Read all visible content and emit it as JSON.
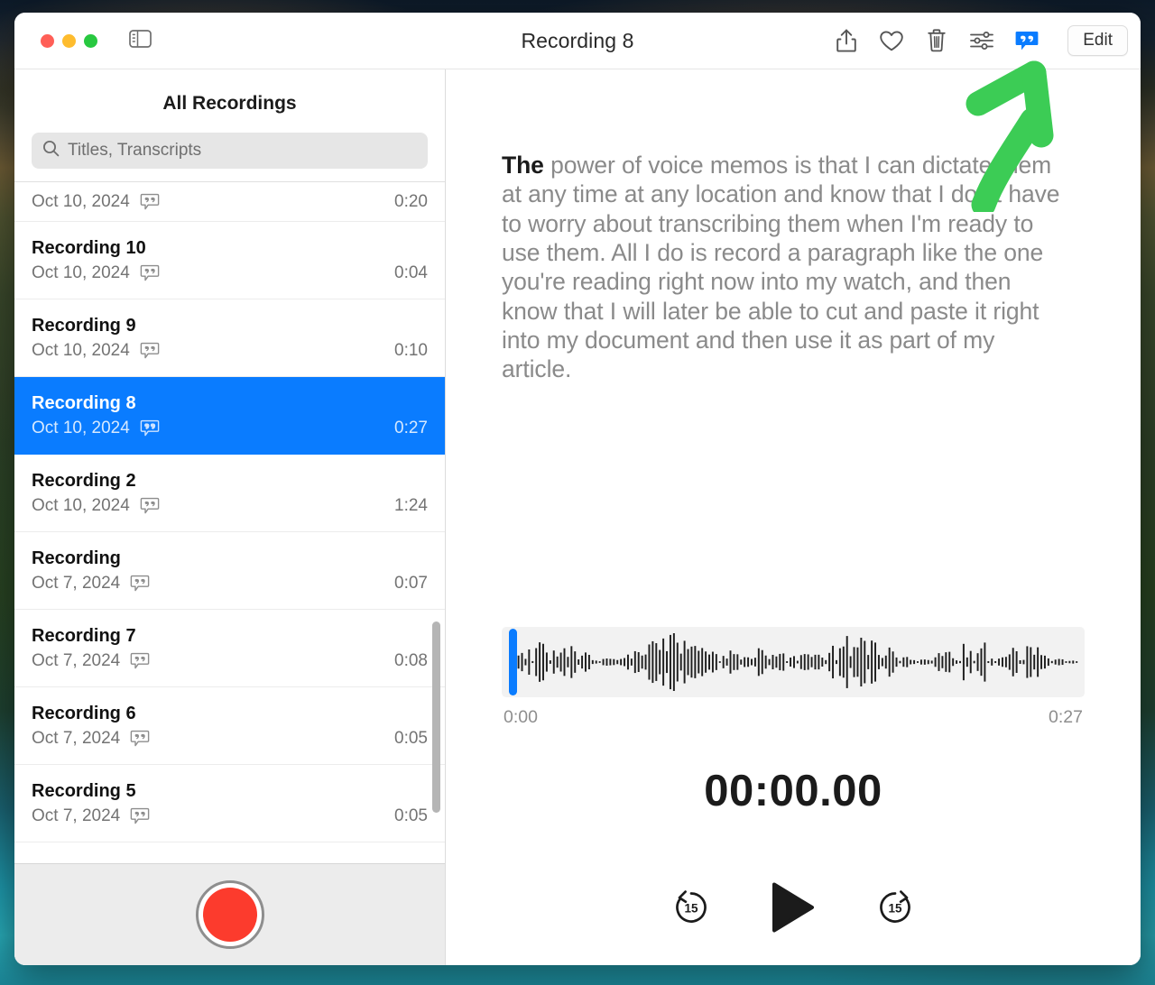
{
  "window": {
    "title": "Recording 8",
    "traffic_lights": [
      "close",
      "minimize",
      "maximize"
    ],
    "sidebar_toggle_icon": "sidebar-toggle-icon"
  },
  "toolbar": {
    "icons": [
      {
        "name": "share-icon",
        "label": "Share"
      },
      {
        "name": "heart-icon",
        "label": "Favorite"
      },
      {
        "name": "trash-icon",
        "label": "Delete"
      },
      {
        "name": "sliders-icon",
        "label": "Enhance"
      },
      {
        "name": "transcript-icon",
        "label": "Transcript",
        "active": true,
        "color": "#0a7cff"
      }
    ],
    "edit_label": "Edit"
  },
  "sidebar": {
    "header": "All Recordings",
    "search": {
      "placeholder": "Titles, Transcripts",
      "value": "",
      "icon": "search-icon"
    },
    "recordings": [
      {
        "title": "",
        "date": "Oct 10, 2024",
        "duration": "0:20",
        "has_transcript": true,
        "selected": false,
        "partial": true
      },
      {
        "title": "Recording 10",
        "date": "Oct 10, 2024",
        "duration": "0:04",
        "has_transcript": true,
        "selected": false,
        "partial": false
      },
      {
        "title": "Recording 9",
        "date": "Oct 10, 2024",
        "duration": "0:10",
        "has_transcript": true,
        "selected": false,
        "partial": false
      },
      {
        "title": "Recording 8",
        "date": "Oct 10, 2024",
        "duration": "0:27",
        "has_transcript": true,
        "selected": true,
        "partial": false
      },
      {
        "title": "Recording 2",
        "date": "Oct 10, 2024",
        "duration": "1:24",
        "has_transcript": true,
        "selected": false,
        "partial": false
      },
      {
        "title": "Recording",
        "date": "Oct 7, 2024",
        "duration": "0:07",
        "has_transcript": true,
        "selected": false,
        "partial": false
      },
      {
        "title": "Recording 7",
        "date": "Oct 7, 2024",
        "duration": "0:08",
        "has_transcript": true,
        "selected": false,
        "partial": false
      },
      {
        "title": "Recording 6",
        "date": "Oct 7, 2024",
        "duration": "0:05",
        "has_transcript": true,
        "selected": false,
        "partial": false
      },
      {
        "title": "Recording 5",
        "date": "Oct 7, 2024",
        "duration": "0:05",
        "has_transcript": true,
        "selected": false,
        "partial": false
      }
    ],
    "record_button": "record-button"
  },
  "detail": {
    "transcript": {
      "current_word": "The",
      "rest": " power of voice memos is that I can dictate them at any time at any location and know that I don't have to worry about transcribing them when I'm ready to use them. All I do is record a paragraph like the one you're reading right now into my watch, and then know that I will later be able to cut and paste it right into my document and then use it as part of my article."
    },
    "player": {
      "start_time": "0:00",
      "end_time": "0:27",
      "elapsed": "00:00.00",
      "playhead_position_pct": 0,
      "controls": [
        {
          "name": "skip-back-15-button",
          "label": "15"
        },
        {
          "name": "play-button",
          "label": "Play"
        },
        {
          "name": "skip-forward-15-button",
          "label": "15"
        }
      ]
    }
  },
  "annotation": {
    "arrow_color": "#3ccc55",
    "points_to": "transcript-icon"
  },
  "colors": {
    "accent_blue": "#0a7cff",
    "record_red": "#fc3b2d",
    "annotation_green": "#3ccc55"
  }
}
